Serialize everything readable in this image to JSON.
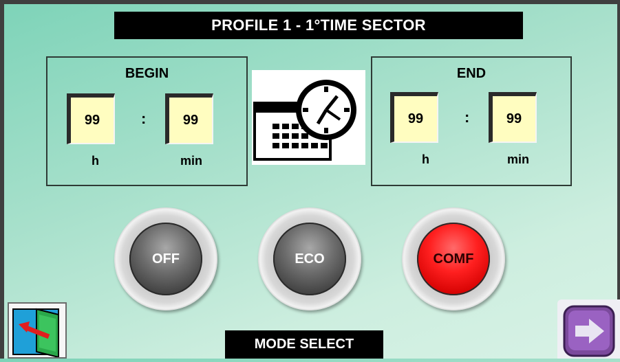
{
  "title": "PROFILE 1  -  1°TIME SECTOR",
  "begin": {
    "label": "BEGIN",
    "hours": "99",
    "minutes": "99",
    "separator": ":",
    "hours_unit": "h",
    "minutes_unit": "min"
  },
  "end": {
    "label": "END",
    "hours": "99",
    "minutes": "99",
    "separator": ":",
    "hours_unit": "h",
    "minutes_unit": "min"
  },
  "modes": [
    {
      "label": "OFF",
      "active": false
    },
    {
      "label": "ECO",
      "active": false
    },
    {
      "label": "COMF",
      "active": true
    }
  ],
  "bottom_label": "MODE SELECT",
  "icons": {
    "clock": "clock-calendar-icon",
    "back": "exit-door-icon",
    "next": "arrow-right-icon"
  },
  "colors": {
    "field_bg": "#fffdc0",
    "active_mode": "#ff2020",
    "next_button": "#7b4a9c"
  }
}
